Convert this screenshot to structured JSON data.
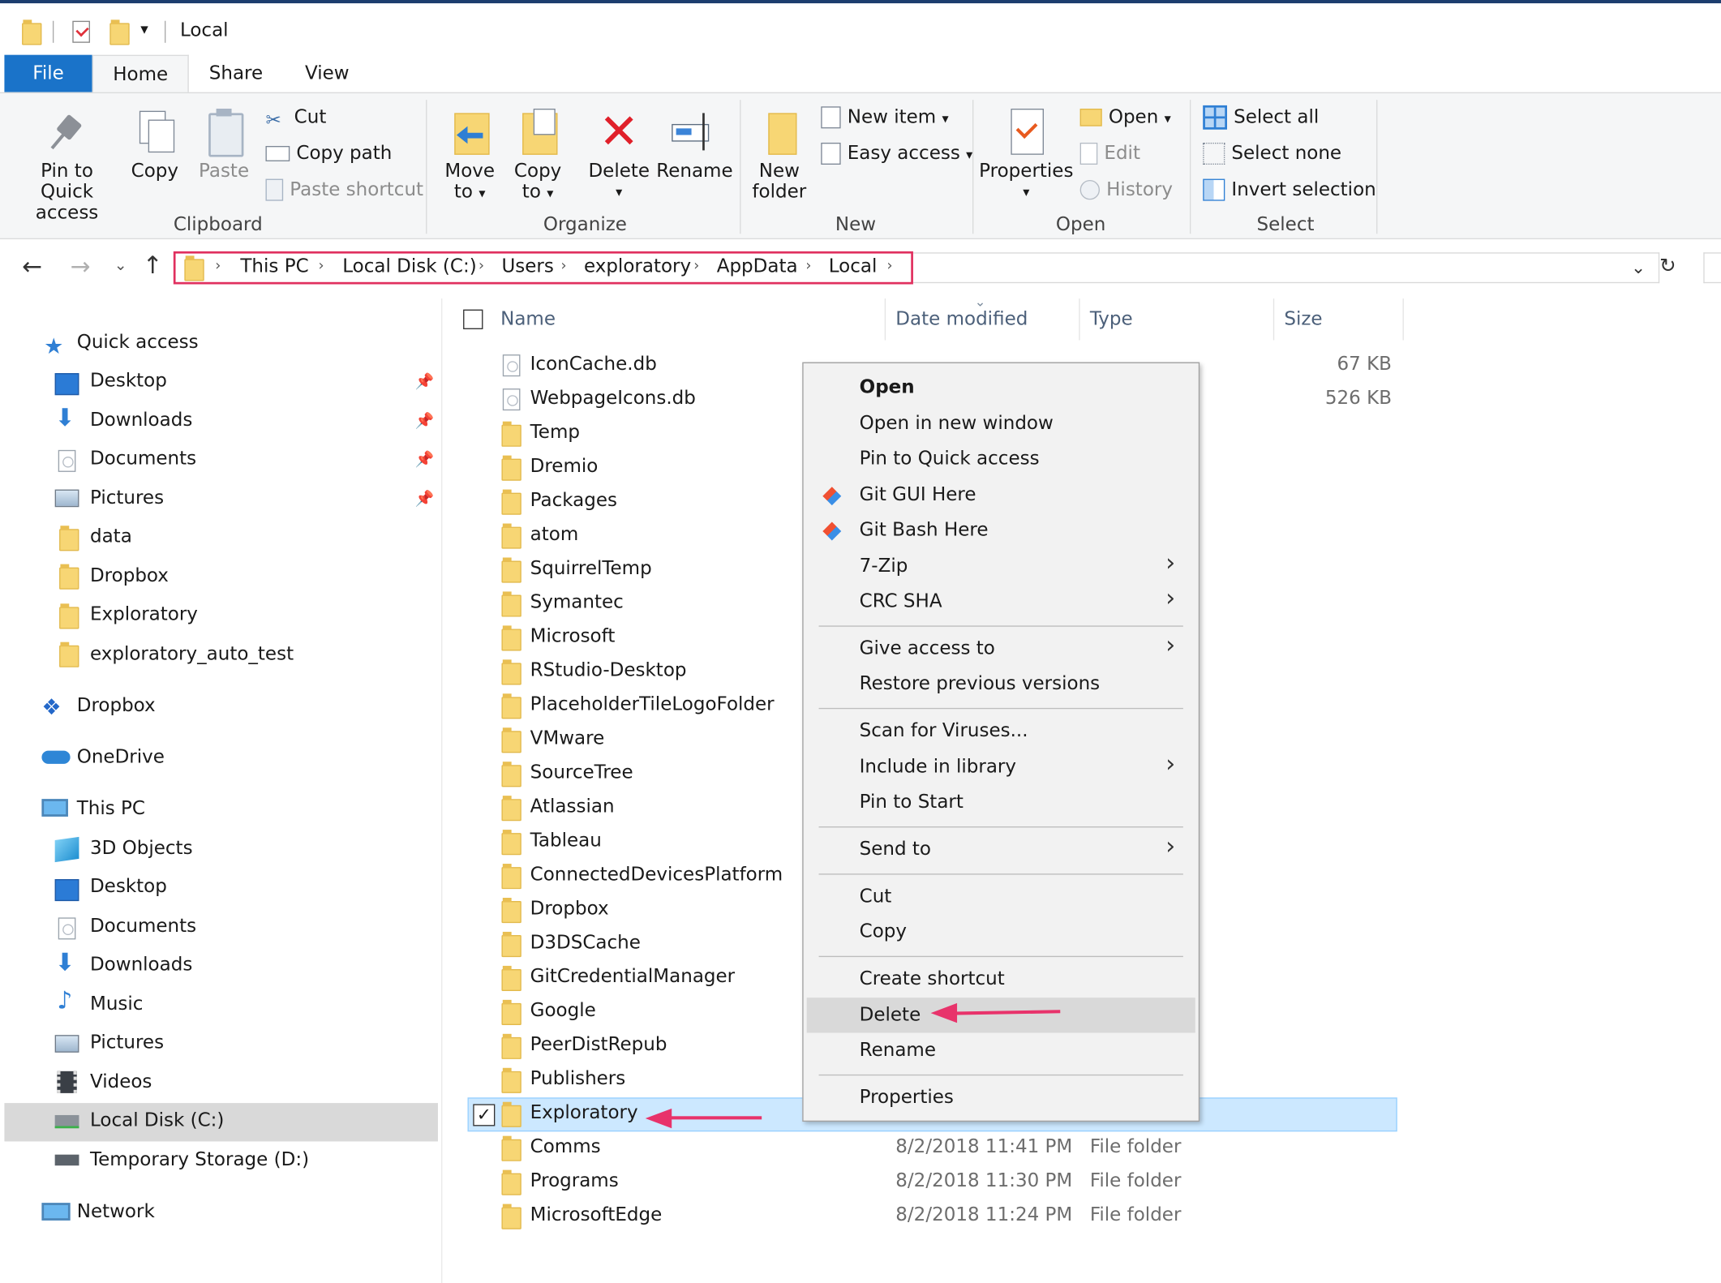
{
  "window": {
    "title": "Local"
  },
  "tabs": {
    "file": "File",
    "home": "Home",
    "share": "Share",
    "view": "View"
  },
  "ribbon": {
    "clipboard": {
      "label": "Clipboard",
      "pin_l1": "Pin to Quick",
      "pin_l2": "access",
      "copy": "Copy",
      "paste": "Paste",
      "cut": "Cut",
      "copy_path": "Copy path",
      "paste_shortcut": "Paste shortcut"
    },
    "organize": {
      "label": "Organize",
      "move_l1": "Move",
      "move_l2": "to",
      "copy_l1": "Copy",
      "copy_l2": "to",
      "delete": "Delete",
      "rename": "Rename"
    },
    "new": {
      "label": "New",
      "folder_l1": "New",
      "folder_l2": "folder",
      "new_item": "New item",
      "easy_access": "Easy access"
    },
    "open": {
      "label": "Open",
      "properties": "Properties",
      "open": "Open",
      "edit": "Edit",
      "history": "History"
    },
    "select": {
      "label": "Select",
      "select_all": "Select all",
      "select_none": "Select none",
      "invert": "Invert selection"
    }
  },
  "address": {
    "crumbs": [
      "This PC",
      "Local Disk (C:)",
      "Users",
      "exploratory",
      "AppData",
      "Local"
    ]
  },
  "nav": {
    "quick_access": "Quick access",
    "quick_items": [
      "Desktop",
      "Downloads",
      "Documents",
      "Pictures",
      "data",
      "Dropbox",
      "Exploratory",
      "exploratory_auto_test"
    ],
    "dropbox": "Dropbox",
    "onedrive": "OneDrive",
    "this_pc": "This PC",
    "pc_items": [
      "3D Objects",
      "Desktop",
      "Documents",
      "Downloads",
      "Music",
      "Pictures",
      "Videos",
      "Local Disk (C:)",
      "Temporary Storage (D:)"
    ],
    "network": "Network"
  },
  "columns": {
    "name": "Name",
    "date": "Date modified",
    "type": "Type",
    "size": "Size"
  },
  "files": [
    {
      "name": "IconCache.db",
      "date": "",
      "type": "",
      "size": "67 KB"
    },
    {
      "name": "WebpageIcons.db",
      "date": "",
      "type": "",
      "size": "526 KB"
    },
    {
      "name": "Temp"
    },
    {
      "name": "Dremio"
    },
    {
      "name": "Packages"
    },
    {
      "name": "atom"
    },
    {
      "name": "SquirrelTemp"
    },
    {
      "name": "Symantec"
    },
    {
      "name": "Microsoft"
    },
    {
      "name": "RStudio-Desktop"
    },
    {
      "name": "PlaceholderTileLogoFolder"
    },
    {
      "name": "VMware"
    },
    {
      "name": "SourceTree"
    },
    {
      "name": "Atlassian"
    },
    {
      "name": "Tableau"
    },
    {
      "name": "ConnectedDevicesPlatform"
    },
    {
      "name": "Dropbox"
    },
    {
      "name": "D3DSCache"
    },
    {
      "name": "GitCredentialManager"
    },
    {
      "name": "Google"
    },
    {
      "name": "PeerDistRepub"
    },
    {
      "name": "Publishers"
    },
    {
      "name": "Exploratory"
    },
    {
      "name": "Comms",
      "date": "8/2/2018 11:41 PM",
      "type": "File folder"
    },
    {
      "name": "Programs",
      "date": "8/2/2018 11:30 PM",
      "type": "File folder"
    },
    {
      "name": "MicrosoftEdge",
      "date": "8/2/2018 11:24 PM",
      "type": "File folder"
    }
  ],
  "context_menu": {
    "open": "Open",
    "open_new_window": "Open in new window",
    "pin_quick": "Pin to Quick access",
    "git_gui": "Git GUI Here",
    "git_bash": "Git Bash Here",
    "zip": "7-Zip",
    "crc": "CRC SHA",
    "give_access": "Give access to",
    "restore": "Restore previous versions",
    "scan": "Scan for Viruses...",
    "include_library": "Include in library",
    "pin_start": "Pin to Start",
    "send_to": "Send to",
    "cut": "Cut",
    "copy": "Copy",
    "create_shortcut": "Create shortcut",
    "delete": "Delete",
    "rename": "Rename",
    "properties": "Properties"
  },
  "colors": {
    "file_tab": "#1a73c9",
    "address_highlight": "#e0305f",
    "arrow": "#e8336b",
    "selection": "#cce8ff",
    "folder": "#f7d674"
  }
}
